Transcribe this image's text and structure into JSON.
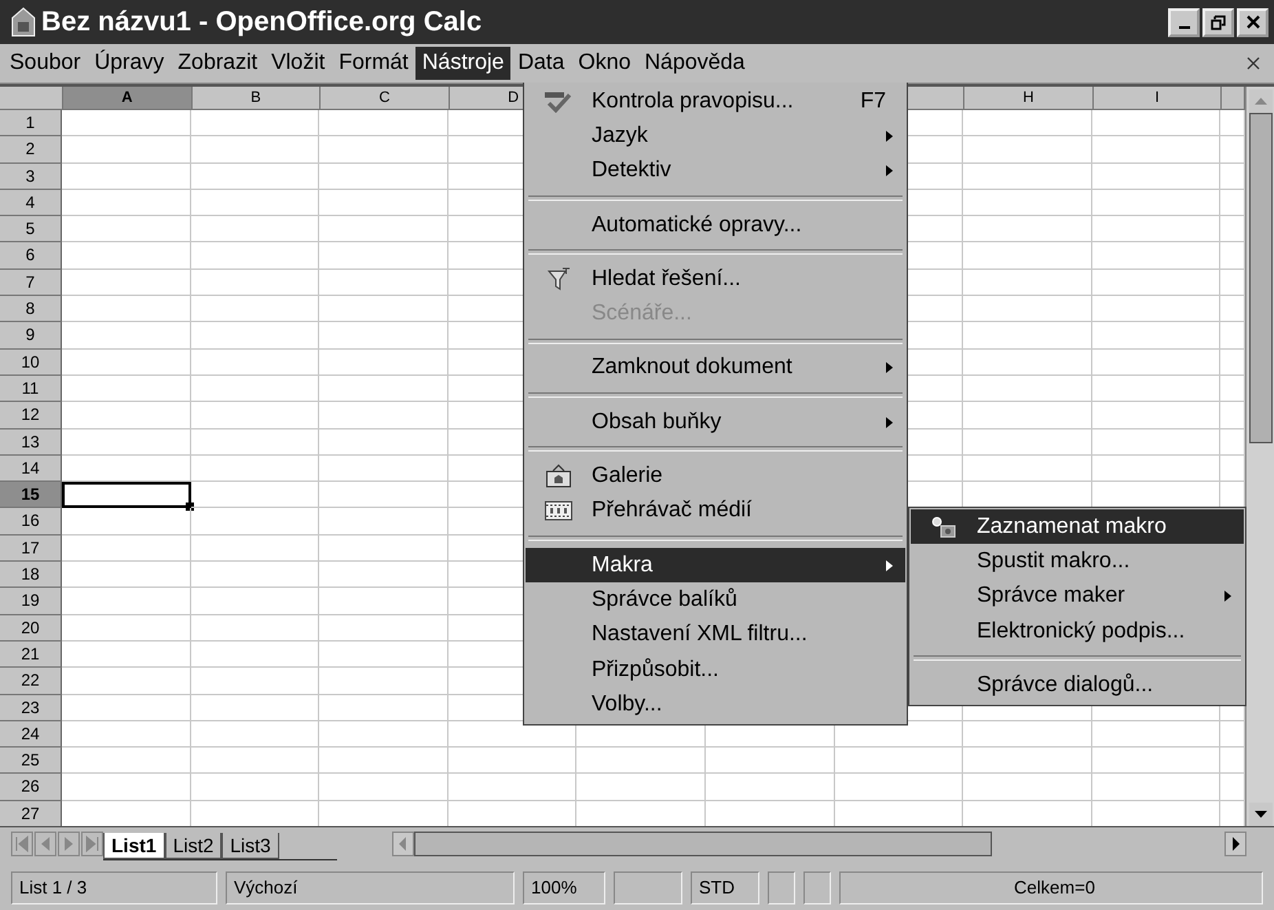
{
  "window": {
    "title": "Bez názvu1 - OpenOffice.org Calc"
  },
  "menubar": [
    {
      "label": "Soubor",
      "selected": false
    },
    {
      "label": "Úpravy",
      "selected": false
    },
    {
      "label": "Zobrazit",
      "selected": false
    },
    {
      "label": "Vložit",
      "selected": false
    },
    {
      "label": "Formát",
      "selected": false
    },
    {
      "label": "Nástroje",
      "selected": true
    },
    {
      "label": "Data",
      "selected": false
    },
    {
      "label": "Okno",
      "selected": false
    },
    {
      "label": "Nápověda",
      "selected": false
    }
  ],
  "columns": [
    {
      "label": "A",
      "selected": true
    },
    {
      "label": "B",
      "selected": false
    },
    {
      "label": "C",
      "selected": false
    },
    {
      "label": "D",
      "selected": false
    },
    {
      "label": "H",
      "selected": false
    },
    {
      "label": "I",
      "selected": false
    }
  ],
  "rows": [
    {
      "label": "1",
      "selected": false
    },
    {
      "label": "2",
      "selected": false
    },
    {
      "label": "3",
      "selected": false
    },
    {
      "label": "4",
      "selected": false
    },
    {
      "label": "5",
      "selected": false
    },
    {
      "label": "6",
      "selected": false
    },
    {
      "label": "7",
      "selected": false
    },
    {
      "label": "8",
      "selected": false
    },
    {
      "label": "9",
      "selected": false
    },
    {
      "label": "10",
      "selected": false
    },
    {
      "label": "11",
      "selected": false
    },
    {
      "label": "12",
      "selected": false
    },
    {
      "label": "13",
      "selected": false
    },
    {
      "label": "14",
      "selected": false
    },
    {
      "label": "15",
      "selected": true
    },
    {
      "label": "16",
      "selected": false
    },
    {
      "label": "17",
      "selected": false
    },
    {
      "label": "18",
      "selected": false
    },
    {
      "label": "19",
      "selected": false
    },
    {
      "label": "20",
      "selected": false
    },
    {
      "label": "21",
      "selected": false
    },
    {
      "label": "22",
      "selected": false
    },
    {
      "label": "23",
      "selected": false
    },
    {
      "label": "24",
      "selected": false
    },
    {
      "label": "25",
      "selected": false
    },
    {
      "label": "26",
      "selected": false
    },
    {
      "label": "27",
      "selected": false
    }
  ],
  "tools_menu": [
    {
      "kind": "item",
      "label": "Kontrola pravopisu...",
      "shortcut": "F7",
      "submenu": false,
      "disabled": false,
      "selected": false
    },
    {
      "kind": "item",
      "label": "Jazyk",
      "submenu": true,
      "disabled": false,
      "selected": false
    },
    {
      "kind": "item",
      "label": "Detektiv",
      "submenu": true,
      "disabled": false,
      "selected": false
    },
    {
      "kind": "separator"
    },
    {
      "kind": "item",
      "label": "Automatické opravy...",
      "submenu": false,
      "disabled": false,
      "selected": false
    },
    {
      "kind": "separator"
    },
    {
      "kind": "item",
      "label": "Hledat řešení...",
      "submenu": false,
      "disabled": false,
      "selected": false
    },
    {
      "kind": "item",
      "label": "Scénáře...",
      "submenu": false,
      "disabled": true,
      "selected": false
    },
    {
      "kind": "separator"
    },
    {
      "kind": "item",
      "label": "Zamknout dokument",
      "submenu": true,
      "disabled": false,
      "selected": false
    },
    {
      "kind": "separator"
    },
    {
      "kind": "item",
      "label": "Obsah buňky",
      "submenu": true,
      "disabled": false,
      "selected": false
    },
    {
      "kind": "separator"
    },
    {
      "kind": "item",
      "label": "Galerie",
      "submenu": false,
      "disabled": false,
      "selected": false
    },
    {
      "kind": "item",
      "label": "Přehrávač médií",
      "submenu": false,
      "disabled": false,
      "selected": false
    },
    {
      "kind": "separator"
    },
    {
      "kind": "item",
      "label": "Makra",
      "submenu": true,
      "disabled": false,
      "selected": true
    },
    {
      "kind": "item",
      "label": "Správce balíků",
      "submenu": false,
      "disabled": false,
      "selected": false
    },
    {
      "kind": "item",
      "label": "Nastavení XML filtru...",
      "submenu": false,
      "disabled": false,
      "selected": false
    },
    {
      "kind": "item",
      "label": "Přizpůsobit...",
      "submenu": false,
      "disabled": false,
      "selected": false
    },
    {
      "kind": "item",
      "label": "Volby...",
      "submenu": false,
      "disabled": false,
      "selected": false
    }
  ],
  "macro_submenu": [
    {
      "kind": "item",
      "label": "Zaznamenat makro",
      "submenu": false,
      "disabled": false,
      "selected": true
    },
    {
      "kind": "item",
      "label": "Spustit makro...",
      "submenu": false,
      "disabled": false,
      "selected": false
    },
    {
      "kind": "item",
      "label": "Správce maker",
      "submenu": true,
      "disabled": false,
      "selected": false
    },
    {
      "kind": "item",
      "label": "Elektronický podpis...",
      "submenu": false,
      "disabled": false,
      "selected": false
    },
    {
      "kind": "separator"
    },
    {
      "kind": "item",
      "label": "Správce dialogů...",
      "submenu": false,
      "disabled": false,
      "selected": false
    }
  ],
  "sheet_tabs": [
    {
      "label": "List1",
      "selected": true
    },
    {
      "label": "List2",
      "selected": false
    },
    {
      "label": "List3",
      "selected": false
    }
  ],
  "status_bar": [
    {
      "kind": "panel",
      "text": "List 1 / 3"
    },
    {
      "kind": "panel",
      "text": "Výchozí"
    },
    {
      "kind": "panel",
      "text": "100%"
    },
    {
      "kind": "blank"
    },
    {
      "kind": "panel",
      "text": "STD"
    },
    {
      "kind": "blank"
    },
    {
      "kind": "blank"
    },
    {
      "kind": "panel",
      "text": "Celkem=0"
    }
  ]
}
